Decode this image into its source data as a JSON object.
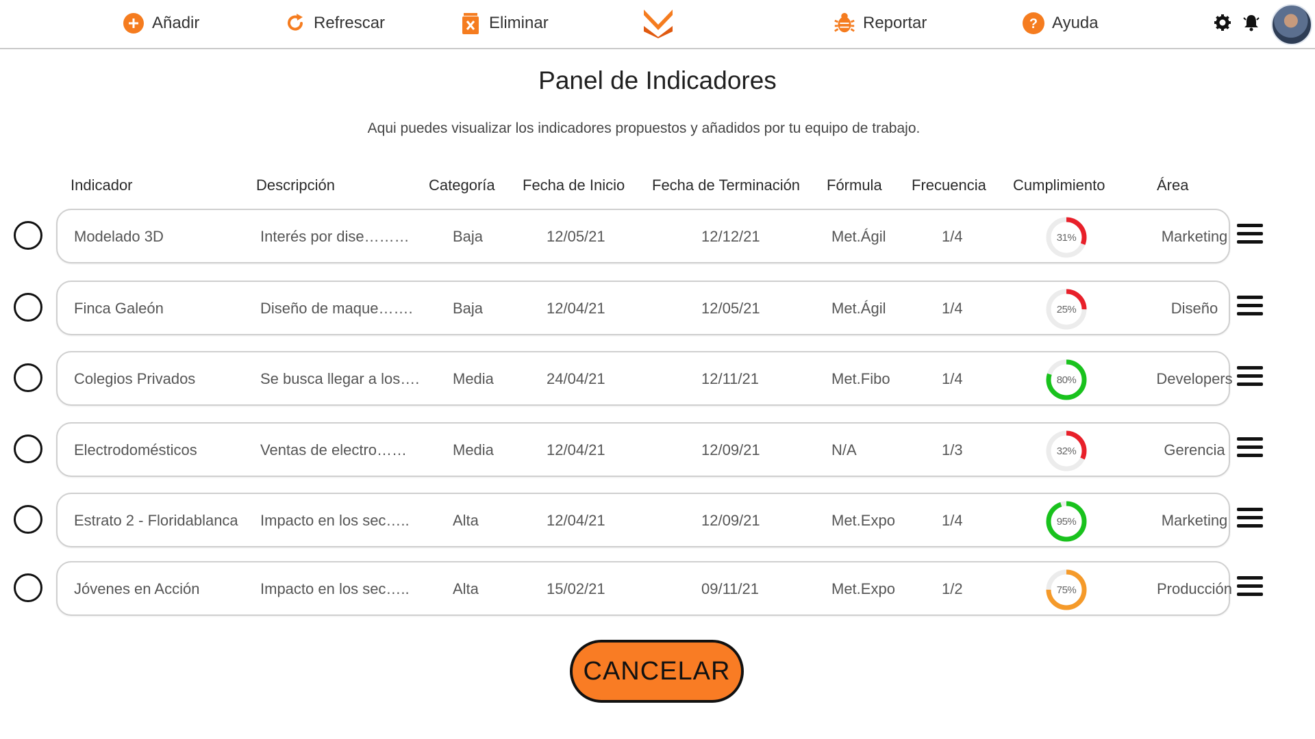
{
  "toolbar": {
    "add_label": "Añadir",
    "refresh_label": "Refrescar",
    "delete_label": "Eliminar",
    "report_label": "Reportar",
    "help_label": "Ayuda",
    "accent": "#f57c1f"
  },
  "page": {
    "title": "Panel de Indicadores",
    "subtitle": "Aqui puedes visualizar los indicadores propuestos y añadidos por tu equipo de trabajo."
  },
  "table": {
    "headers": [
      "Indicador",
      "Descripción",
      "Categoría",
      "Fecha de Inicio",
      "Fecha de Terminación",
      "Fórmula",
      "Frecuencia",
      "Cumplimiento",
      "Área"
    ],
    "rows": [
      {
        "indicador": "Modelado 3D",
        "descripcion": "Interés por dise………",
        "categoria": "Baja",
        "inicio": "12/05/21",
        "fin": "12/12/21",
        "formula": "Met.Ágil",
        "frecuencia": "1/4",
        "cumplimiento": 31,
        "cumplimiento_label": "31%",
        "color": "#e8202a",
        "area": "Marketing"
      },
      {
        "indicador": "Finca Galeón",
        "descripcion": "Diseño de maque…….",
        "categoria": "Baja",
        "inicio": "12/04/21",
        "fin": "12/05/21",
        "formula": "Met.Ágil",
        "frecuencia": "1/4",
        "cumplimiento": 25,
        "cumplimiento_label": "25%",
        "color": "#e8202a",
        "area": "Diseño"
      },
      {
        "indicador": "Colegios Privados",
        "descripcion": "Se busca llegar a los….",
        "categoria": "Media",
        "inicio": "24/04/21",
        "fin": "12/11/21",
        "formula": "Met.Fibo",
        "frecuencia": "1/4",
        "cumplimiento": 80,
        "cumplimiento_label": "80%",
        "color": "#19c21d",
        "area": "Developers"
      },
      {
        "indicador": "Electrodomésticos",
        "descripcion": "Ventas de electro……",
        "categoria": "Media",
        "inicio": "12/04/21",
        "fin": "12/09/21",
        "formula": "N/A",
        "frecuencia": "1/3",
        "cumplimiento": 32,
        "cumplimiento_label": "32%",
        "color": "#e8202a",
        "area": "Gerencia"
      },
      {
        "indicador": "Estrato 2 - Floridablanca",
        "descripcion": "Impacto en los sec…..",
        "categoria": "Alta",
        "inicio": "12/04/21",
        "fin": "12/09/21",
        "formula": "Met.Expo",
        "frecuencia": "1/4",
        "cumplimiento": 95,
        "cumplimiento_label": "95%",
        "color": "#19c21d",
        "area": "Marketing"
      },
      {
        "indicador": "Jóvenes en Acción",
        "descripcion": "Impacto en los sec…..",
        "categoria": "Alta",
        "inicio": "15/02/21",
        "fin": "09/11/21",
        "formula": "Met.Expo",
        "frecuencia": "1/2",
        "cumplimiento": 75,
        "cumplimiento_label": "75%",
        "color": "#f59a2a",
        "area": "Producción"
      }
    ]
  },
  "footer": {
    "cancel_label": "CANCELAR",
    "cancel_color": "#f97c24"
  }
}
